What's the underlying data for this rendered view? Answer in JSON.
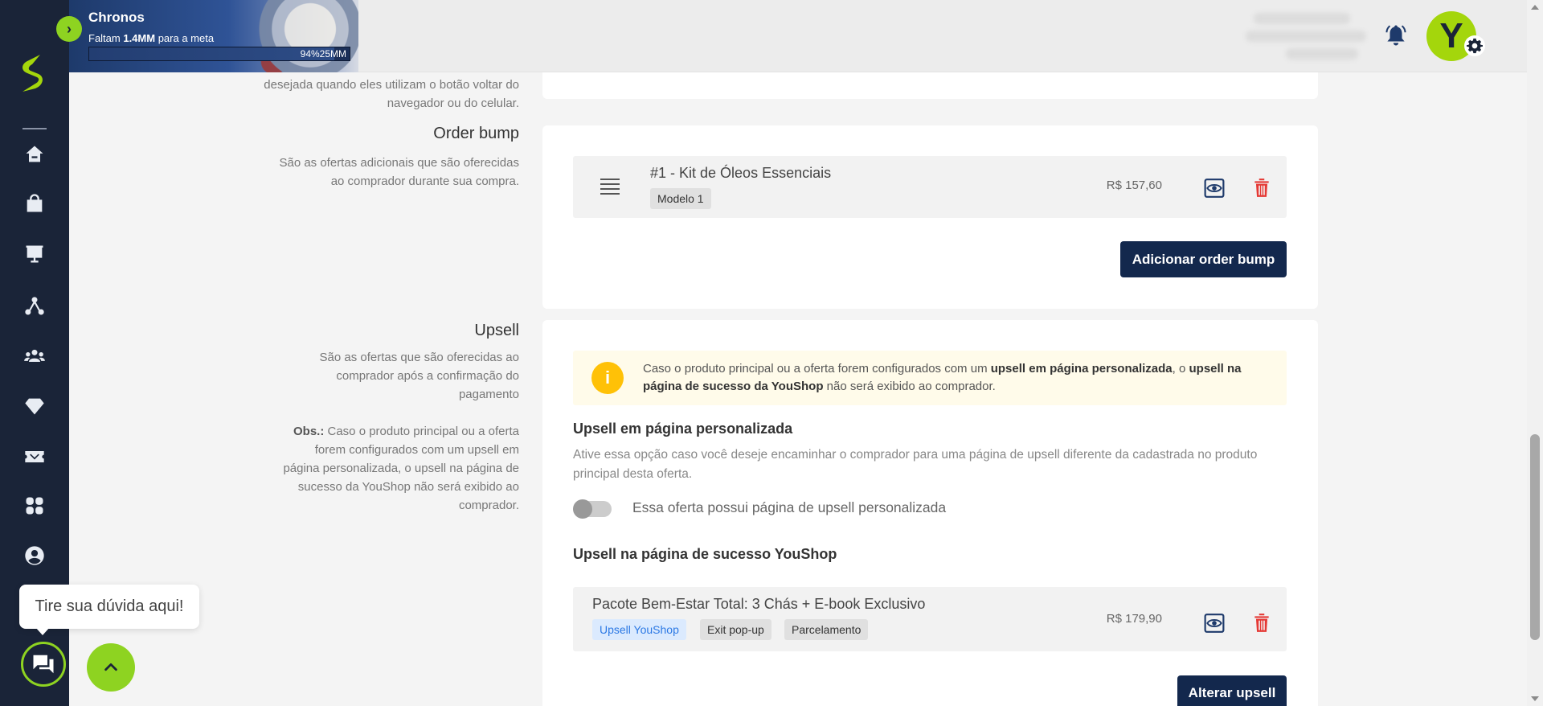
{
  "goal": {
    "title": "Chronos",
    "subtitle_prefix": "Faltam ",
    "subtitle_amount": "1.4MM",
    "subtitle_suffix": " para a meta",
    "progress_text": "94%25MM",
    "progress_percent": 94
  },
  "sidebar": {
    "items": [
      {
        "name": "home-icon"
      },
      {
        "name": "shopping-bag-icon"
      },
      {
        "name": "presentation-chart-icon"
      },
      {
        "name": "network-icon"
      },
      {
        "name": "users-icon"
      },
      {
        "name": "diamond-icon"
      },
      {
        "name": "ticket-icon"
      },
      {
        "name": "apps-icon"
      },
      {
        "name": "user-circle-icon"
      }
    ]
  },
  "header": {
    "avatar_letter": "Y"
  },
  "sections": {
    "back_redirect": {
      "description": "desejada quando eles utilizam o botão voltar do navegador ou do celular."
    },
    "order_bump": {
      "title": "Order bump",
      "description": "São as ofertas adicionais que são oferecidas ao comprador durante sua compra.",
      "items": [
        {
          "title": "#1 - Kit de Óleos Essenciais",
          "tag": "Modelo 1",
          "price": "R$ 157,60"
        }
      ],
      "add_button": "Adicionar order bump"
    },
    "upsell": {
      "title": "Upsell",
      "description": "São as ofertas que são oferecidas ao comprador após a confirmação do pagamento",
      "obs_label": "Obs.:",
      "obs_text": " Caso o produto principal ou a oferta forem configurados com um upsell em página personalizada, o upsell na página de sucesso da YouShop não será exibido ao comprador.",
      "alert": {
        "p1": "Caso o produto principal ou a oferta forem configurados com um ",
        "b1": "upsell em página personalizada",
        "p2": ", o ",
        "b2": "upsell na página de sucesso da YouShop",
        "p3": " não será exibido ao comprador."
      },
      "custom_page": {
        "label": "Upsell em página personalizada",
        "help": "Ative essa opção caso você deseje encaminhar o comprador para uma página de upsell diferente da cadastrada no produto principal desta oferta.",
        "toggle_label": "Essa oferta possui página de upsell personalizada",
        "enabled": false
      },
      "success_page": {
        "label": "Upsell na página de sucesso YouShop",
        "item": {
          "title": "Pacote Bem-Estar Total: 3 Chás + E-book Exclusivo",
          "tags": [
            "Upsell YouShop",
            "Exit pop-up",
            "Parcelamento"
          ],
          "price": "R$ 179,90"
        }
      },
      "change_button": "Alterar upsell"
    }
  },
  "chat": {
    "tooltip": "Tire sua dúvida aqui!"
  },
  "colors": {
    "sidebar_bg": "#1a2438",
    "accent_green": "#8ed321",
    "primary_button": "#13284d",
    "danger": "#e53935",
    "alert_bg": "#fffbea",
    "alert_icon": "#ffc107"
  }
}
